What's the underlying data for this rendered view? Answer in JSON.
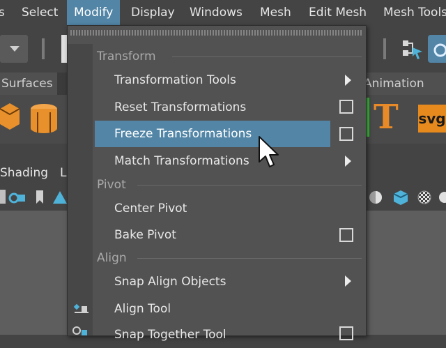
{
  "menubar": {
    "items": [
      {
        "label": "s"
      },
      {
        "label": "Select"
      },
      {
        "label": "Modify"
      },
      {
        "label": "Display"
      },
      {
        "label": "Windows"
      },
      {
        "label": "Mesh"
      },
      {
        "label": "Edit Mesh"
      },
      {
        "label": "Mesh Tools"
      }
    ]
  },
  "shelf": {
    "tabs": [
      {
        "label": "Surfaces"
      },
      {
        "label": "Animation"
      }
    ],
    "svg_label": "svg",
    "text_tool_glyph": "T"
  },
  "panel": {
    "menu_shading": "Shading",
    "menu_cut": "L"
  },
  "menu": {
    "sections": {
      "transform": "Transform",
      "pivot": "Pivot",
      "align": "Align"
    },
    "items": {
      "transformation_tools": "Transformation Tools",
      "reset_transformations": "Reset Transformations",
      "freeze_transformations": "Freeze Transformations",
      "match_transformations": "Match Transformations",
      "center_pivot": "Center Pivot",
      "bake_pivot": "Bake Pivot",
      "snap_align_objects": "Snap Align Objects",
      "align_tool": "Align Tool",
      "snap_together_tool": "Snap Together Tool"
    }
  },
  "colors": {
    "highlight": "#5285a6",
    "menu_bg": "#525252",
    "accent_orange": "#e68a1e"
  }
}
